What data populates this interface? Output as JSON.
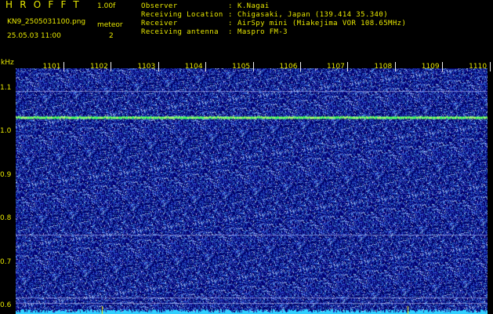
{
  "header": {
    "app_title": "HROFFT",
    "version": "1.00f",
    "filename": "KN9_2505031100.png",
    "mode_label": "meteor",
    "datetime": "25.05.03 11:00",
    "mode_value": "2",
    "info": [
      {
        "label": "Observer",
        "value": "K.Nagai"
      },
      {
        "label": "Receiving Location",
        "value": "Chigasaki, Japan (139.414 35.340)"
      },
      {
        "label": "Receiver",
        "value": "AirSpy mini (Miakejima VOR 108.65MHz)"
      },
      {
        "label": "Receiving antenna",
        "value": "Maspro FM-3"
      }
    ]
  },
  "spectrogram": {
    "y_unit": "kHz",
    "time_ticks": [
      "1101",
      "1102",
      "1103",
      "1104",
      "1105",
      "1106",
      "1107",
      "1108",
      "1109",
      "1110"
    ],
    "freq_ticks": [
      "1.1",
      "1.0",
      "0.9",
      "0.8",
      "0.7",
      "0.6"
    ],
    "freq_range_khz": [
      0.58,
      1.145
    ],
    "carrier_khz": 1.032,
    "faint_lines_khz": [
      1.092,
      0.762,
      0.618,
      0.605
    ],
    "colors": {
      "text": "#e8e800",
      "background": "#00006a",
      "noise": "#3050c8",
      "carrier": "#40ff60",
      "baseline": "#30d0ff"
    }
  }
}
